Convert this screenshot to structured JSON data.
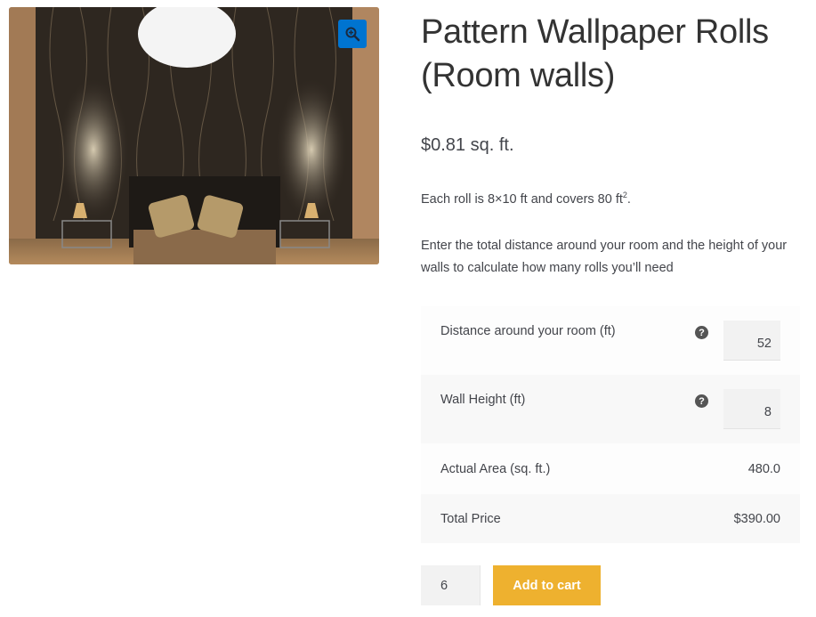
{
  "product": {
    "title_line1": "Pattern Wallpaper Rolls",
    "title_line2": "(Room walls)",
    "price": "$0.81 sq. ft.",
    "description_1_prefix": "Each roll is 8×10 ft and covers 80 ft",
    "description_1_sup": "2",
    "description_1_suffix": ".",
    "description_2": "Enter the total distance around your room and the height of your walls to calculate how many rolls you’ll need",
    "image_alt": "Bedroom with dark patterned wallpaper, bed with polka dot pillows and two bedside lamps"
  },
  "gallery": {
    "zoom_icon": "magnifier-plus-icon"
  },
  "calculator": {
    "fields": [
      {
        "label": "Distance around your room (ft)",
        "value": "52",
        "help_icon": "question-circle-icon"
      },
      {
        "label": "Wall Height (ft)",
        "value": "8",
        "help_icon": "question-circle-icon"
      }
    ],
    "actual_area": {
      "label": "Actual Area (sq. ft.)",
      "value": "480.0"
    },
    "total_price": {
      "label": "Total Price",
      "value": "$390.00"
    }
  },
  "cart": {
    "quantity": "6",
    "add_to_cart_label": "Add to cart"
  },
  "colors": {
    "accent_button": "#eeb12f",
    "zoom_button": "#0074d0",
    "text": "#43454b"
  }
}
